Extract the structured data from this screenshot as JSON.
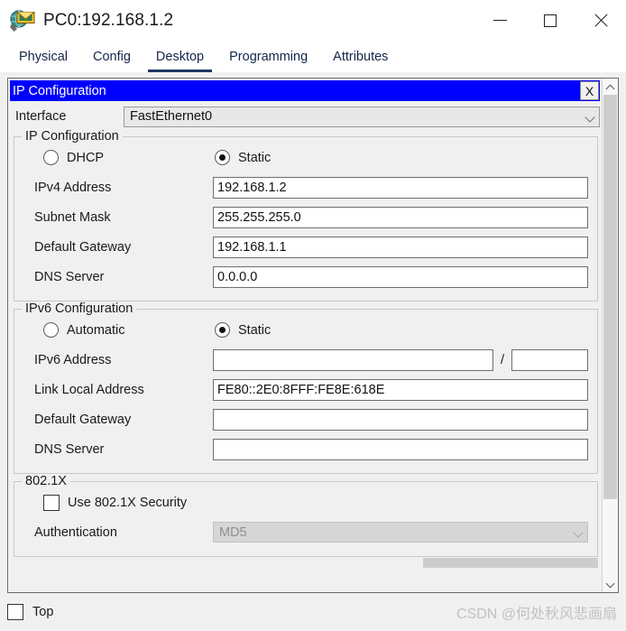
{
  "window": {
    "title": "PC0:192.168.1.2",
    "icon": "packet-tracer-pc-icon",
    "minimize_label": "—",
    "maximize_label": "□",
    "close_label": "✕"
  },
  "tabs": [
    {
      "label": "Physical",
      "active": false
    },
    {
      "label": "Config",
      "active": false
    },
    {
      "label": "Desktop",
      "active": true
    },
    {
      "label": "Programming",
      "active": false
    },
    {
      "label": "Attributes",
      "active": false
    }
  ],
  "dialog": {
    "header_title": "IP Configuration",
    "close_label": "X",
    "header_color": "#0000ff"
  },
  "interface": {
    "label": "Interface",
    "value": "FastEthernet0"
  },
  "ipv4": {
    "legend": "IP Configuration",
    "mode_dhcp": "DHCP",
    "mode_static": "Static",
    "selected_mode": "Static",
    "fields": [
      {
        "label": "IPv4 Address",
        "value": "192.168.1.2"
      },
      {
        "label": "Subnet Mask",
        "value": "255.255.255.0"
      },
      {
        "label": "Default Gateway",
        "value": "192.168.1.1"
      },
      {
        "label": "DNS Server",
        "value": "0.0.0.0"
      }
    ]
  },
  "ipv6": {
    "legend": "IPv6 Configuration",
    "mode_automatic": "Automatic",
    "mode_static": "Static",
    "selected_mode": "Static",
    "address_label": "IPv6 Address",
    "address_value": "",
    "prefix_separator": "/",
    "prefix_value": "",
    "fields": [
      {
        "label": "Link Local Address",
        "value": "FE80::2E0:8FFF:FE8E:618E"
      },
      {
        "label": "Default Gateway",
        "value": ""
      },
      {
        "label": "DNS Server",
        "value": ""
      }
    ]
  },
  "dot1x": {
    "legend": "802.1X",
    "use_security_label": "Use 802.1X Security",
    "use_security_checked": false,
    "authentication_label": "Authentication",
    "authentication_value": "MD5",
    "authentication_disabled": true
  },
  "footer": {
    "top_label": "Top",
    "top_checked": false,
    "watermark": "CSDN @何处秋风悲画扇"
  }
}
